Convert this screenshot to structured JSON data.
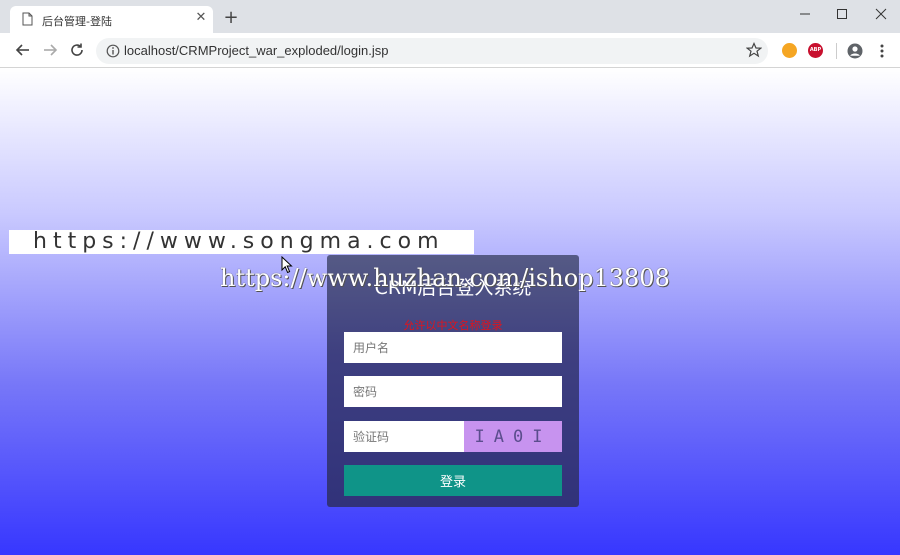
{
  "browser": {
    "tab": {
      "title": "后台管理-登陆"
    },
    "address_bar": {
      "url": "localhost/CRMProject_war_exploded/login.jsp"
    },
    "extensions": {
      "abp_label": "ABP"
    }
  },
  "page": {
    "watermark_site": "https://www.songma.com",
    "watermark_overlay": "https://www.huzhan.com/ishop13808",
    "login": {
      "title": "CRM后台登入系统",
      "hint": "允许以中文名称登录",
      "username_placeholder": "用户名",
      "password_placeholder": "密码",
      "captcha_placeholder": "验证码",
      "captcha_text": "IA0I",
      "submit_label": "登录"
    }
  },
  "colors": {
    "background_top": "#ffffff",
    "background_bottom": "#3737ff",
    "panel": "#3e3f80",
    "submit_button": "#0f9488",
    "hint_text": "#e0131d",
    "captcha_bg": "#c793ef"
  }
}
